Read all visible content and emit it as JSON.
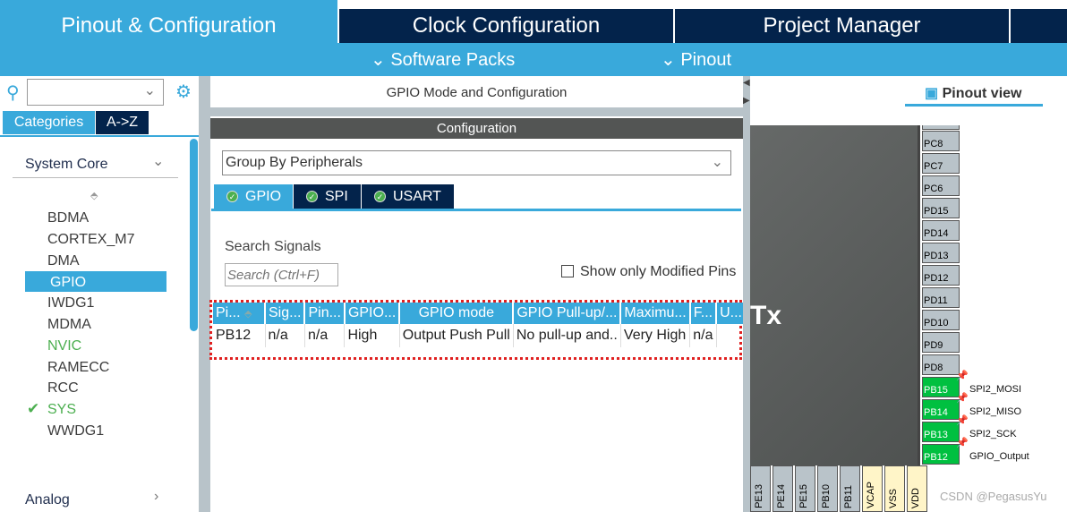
{
  "top_tabs": [
    {
      "label": "Pinout & Configuration",
      "active": true
    },
    {
      "label": "Clock Configuration"
    },
    {
      "label": "Project Manager"
    }
  ],
  "sub_menu": {
    "software_packs": "Software Packs",
    "pinout": "Pinout"
  },
  "sidebar": {
    "search_value": "",
    "tabs": [
      "Categories",
      "A->Z"
    ],
    "section": "System Core",
    "items": [
      "BDMA",
      "CORTEX_M7",
      "DMA",
      "GPIO",
      "IWDG1",
      "MDMA",
      "NVIC",
      "RAMECC",
      "RCC",
      "SYS",
      "WWDG1"
    ],
    "selected": "GPIO",
    "next_section": "Analog"
  },
  "middle": {
    "title": "GPIO Mode and Configuration",
    "config_header": "Configuration",
    "group_by": "Group By Peripherals",
    "tabs": [
      "GPIO",
      "SPI",
      "USART"
    ],
    "search_label": "Search Signals",
    "search_placeholder": "Search (Ctrl+F)",
    "show_modified": "Show only Modified Pins",
    "show_modified_checked": false,
    "table": {
      "headers": [
        "Pi...",
        "Sig...",
        "Pin...",
        "GPIO...",
        "GPIO mode",
        "GPIO Pull-up/...",
        "Maximu...",
        "F...",
        "U...",
        "..."
      ],
      "rows": [
        [
          "PB12",
          "n/a",
          "n/a",
          "High",
          "Output Push Pull",
          "No pull-up and..",
          "Very High",
          "n/a",
          "",
          ""
        ]
      ],
      "row_checked": true
    }
  },
  "pinout": {
    "view_label": "Pinout view",
    "chip_text": "Tx",
    "right_pins": [
      "PC8",
      "PC7",
      "PC6",
      "PD15",
      "PD14",
      "PD13",
      "PD12",
      "PD11",
      "PD10",
      "PD9",
      "PD8",
      "PB15",
      "PB14",
      "PB13",
      "PB12"
    ],
    "signals": {
      "PB15": "SPI2_MOSI",
      "PB14": "SPI2_MISO",
      "PB13": "SPI2_SCK",
      "PB12": "GPIO_Output"
    },
    "bottom_pins": [
      "PE13",
      "PE14",
      "PE15",
      "PB10",
      "PB11",
      "VCAP",
      "VSS",
      "VDD"
    ]
  },
  "watermark": "CSDN @PegasusYu",
  "colors": {
    "accent": "#39a9db",
    "navy": "#03234b",
    "green": "#00c040",
    "highlight_border": "#e02020"
  }
}
